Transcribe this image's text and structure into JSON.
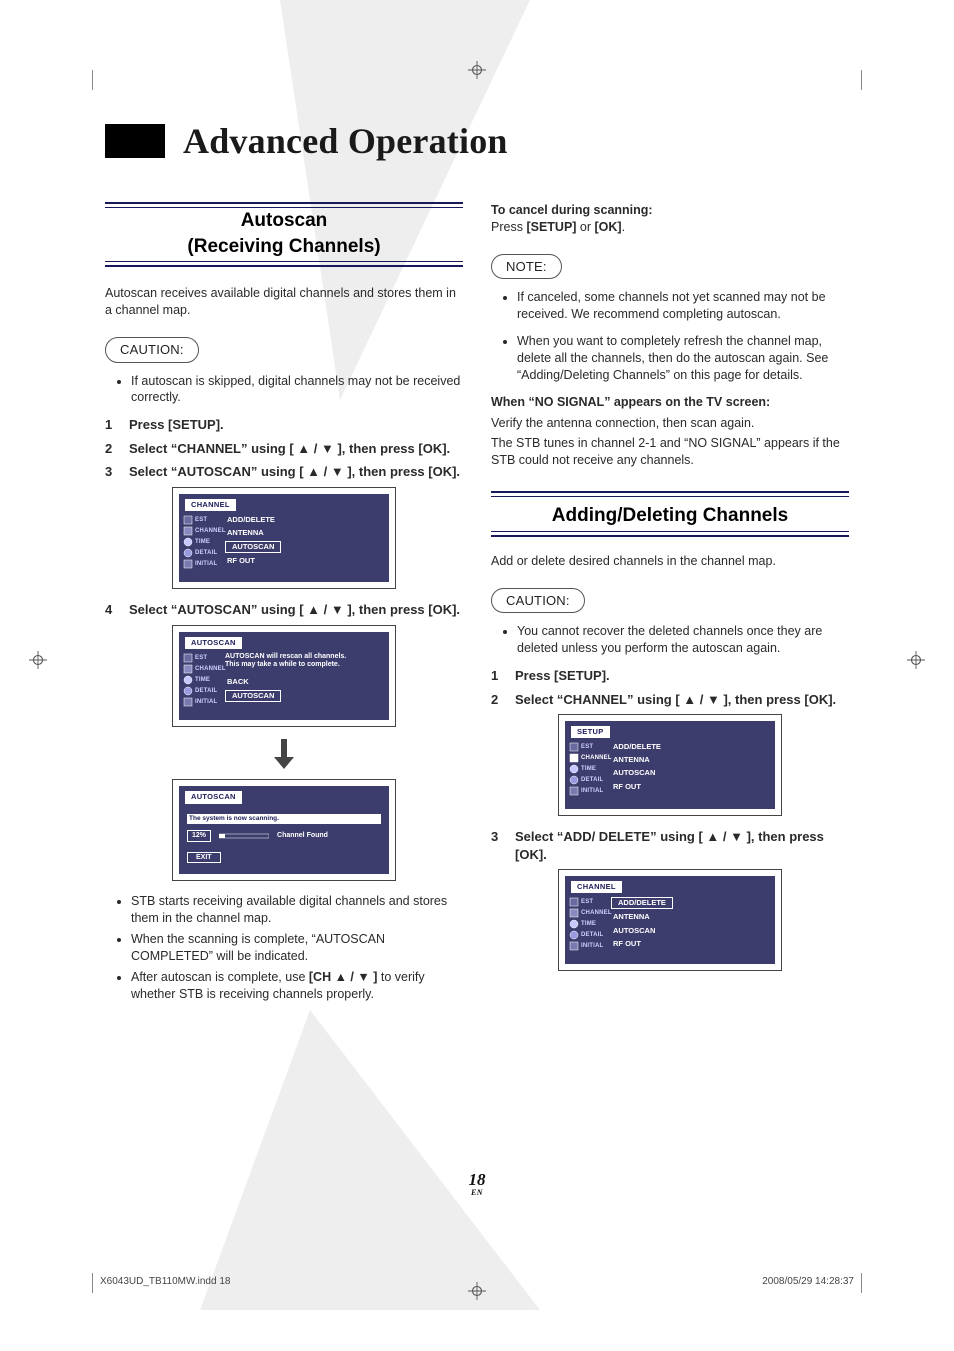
{
  "page_title": "Advanced Operation",
  "reg_icon_name": "registration-mark",
  "autoscan": {
    "heading_line1": "Autoscan",
    "heading_line2": "(Receiving Channels)",
    "intro": "Autoscan receives available digital channels and stores them in a channel map.",
    "caution_label": "CAUTION:",
    "caution_items": [
      "If autoscan is skipped, digital channels may not be received correctly."
    ],
    "steps": [
      {
        "num": "1",
        "text": "Press [SETUP]."
      },
      {
        "num": "2",
        "text": "Select “CHANNEL” using [ ▲ / ▼ ], then press [OK]."
      },
      {
        "num": "3",
        "text": "Select “AUTOSCAN” using [ ▲ / ▼ ], then press [OK]."
      },
      {
        "num": "4",
        "text": "Select “AUTOSCAN” using [ ▲ / ▼ ], then press [OK]."
      }
    ],
    "osd1": {
      "tab": "CHANNEL",
      "side": [
        "EST",
        "CHANNEL",
        "TIME",
        "DETAIL",
        "INITIAL"
      ],
      "items": [
        "ADD/DELETE",
        "ANTENNA",
        "AUTOSCAN",
        "RF OUT"
      ],
      "selected": "AUTOSCAN"
    },
    "osd2": {
      "tab": "AUTOSCAN",
      "side": [
        "EST",
        "CHANNEL",
        "TIME",
        "DETAIL",
        "INITIAL"
      ],
      "msg_line1": "AUTOSCAN will rescan all channels.",
      "msg_line2": "This may take a while to complete.",
      "items": [
        "BACK",
        "AUTOSCAN"
      ],
      "selected": "AUTOSCAN"
    },
    "osd3": {
      "tab": "AUTOSCAN",
      "scanbar": "The system is now scanning.",
      "percent": "12%",
      "found": "Channel Found",
      "exit": "EXIT"
    },
    "post_bullets": [
      "STB starts receiving available digital channels and stores them in the channel map.",
      "When the scanning is complete, “AUTOSCAN COMPLETED” will be indicated.",
      "After autoscan is complete, use [CH ▲ / ▼ ] to verify whether STB is receiving channels properly."
    ]
  },
  "cancel": {
    "heading": "To cancel during scanning:",
    "text_pre": "Press ",
    "btn1": "[SETUP]",
    "mid": " or ",
    "btn2": "[OK]",
    "tail": "."
  },
  "note": {
    "label": "NOTE:",
    "items": [
      "If canceled, some channels not yet scanned may not be received. We recommend completing autoscan.",
      "When you want to completely refresh the channel map, delete all the channels, then do the autoscan again. See “Adding/Deleting Channels” on this page for details."
    ]
  },
  "nosignal": {
    "heading": "When “NO SIGNAL” appears on the TV screen:",
    "line1": "Verify the antenna connection, then scan again.",
    "line2": "The STB tunes in channel 2-1 and “NO SIGNAL” appears if the STB could not receive any channels."
  },
  "adddel": {
    "heading": "Adding/Deleting Channels",
    "intro": "Add or delete desired channels in the channel map.",
    "caution_label": "CAUTION:",
    "caution_items": [
      "You cannot recover the deleted channels once they are deleted unless you perform the autoscan again."
    ],
    "steps": [
      {
        "num": "1",
        "text": "Press [SETUP]."
      },
      {
        "num": "2",
        "text": "Select “CHANNEL” using [ ▲ / ▼ ], then press [OK]."
      },
      {
        "num": "3",
        "text": "Select “ADD/ DELETE” using [ ▲ / ▼ ], then press [OK]."
      }
    ],
    "osd1": {
      "tab": "SETUP",
      "side": [
        "EST",
        "CHANNEL",
        "TIME",
        "DETAIL",
        "INITIAL"
      ],
      "items": [
        "ADD/DELETE",
        "ANTENNA",
        "AUTOSCAN",
        "RF OUT"
      ],
      "selected": "CHANNEL"
    },
    "osd2": {
      "tab": "CHANNEL",
      "side": [
        "EST",
        "CHANNEL",
        "TIME",
        "DETAIL",
        "INITIAL"
      ],
      "items": [
        "ADD/DELETE",
        "ANTENNA",
        "AUTOSCAN",
        "RF OUT"
      ],
      "selected": "ADD/DELETE"
    }
  },
  "page_number": "18",
  "page_lang": "EN",
  "footer_left": "X6043UD_TB110MW.indd   18",
  "footer_right": "2008/05/29   14:28:37"
}
